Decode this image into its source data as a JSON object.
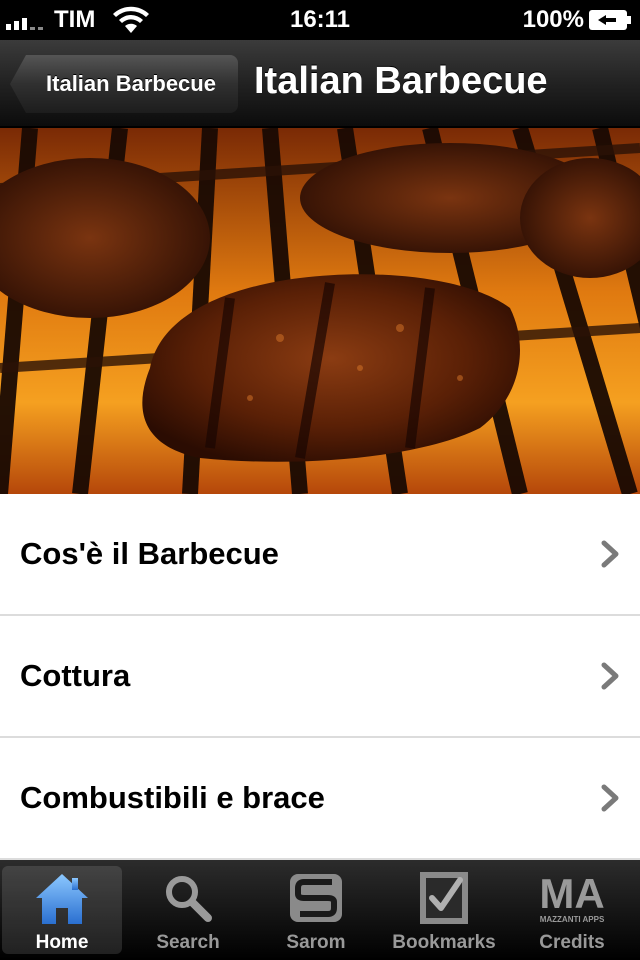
{
  "status_bar": {
    "carrier": "TIM",
    "time": "16:11",
    "battery": "100%"
  },
  "nav_bar": {
    "back_label": "Italian Barbecue",
    "title": "Italian Barbecue"
  },
  "hero": {
    "description_icon": "grilled-meat-photo"
  },
  "menu": {
    "items": [
      {
        "label": "Cos'è il Barbecue"
      },
      {
        "label": "Cottura"
      },
      {
        "label": "Combustibili e brace"
      }
    ]
  },
  "tab_bar": {
    "tabs": [
      {
        "label": "Home",
        "icon": "house-icon",
        "active": true
      },
      {
        "label": "Search",
        "icon": "magnifier-icon",
        "active": false
      },
      {
        "label": "Sarom",
        "icon": "sarom-logo-icon",
        "active": false
      },
      {
        "label": "Bookmarks",
        "icon": "bookmark-check-icon",
        "active": false
      },
      {
        "label": "Credits",
        "icon": "mazzanti-apps-logo",
        "active": false
      }
    ],
    "credits_logo_text": "MA",
    "credits_logo_subtext": "MAZZANTI APPS"
  },
  "colors": {
    "home_icon_blue": "#3f8fe0",
    "list_background": "#ffffff",
    "chevron_gray": "#7a7a7a"
  }
}
